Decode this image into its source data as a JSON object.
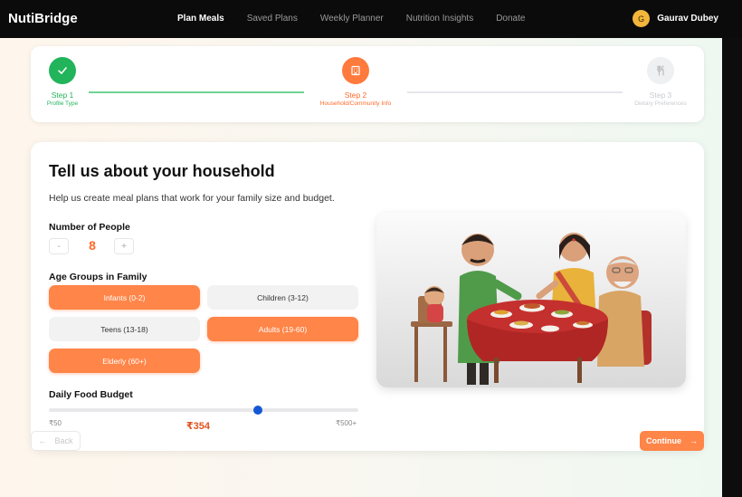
{
  "app": {
    "brand": "NutiBridge"
  },
  "nav": {
    "items": [
      {
        "label": "Plan Meals",
        "active": true
      },
      {
        "label": "Saved Plans",
        "active": false
      },
      {
        "label": "Weekly Planner",
        "active": false
      },
      {
        "label": "Nutrition Insights",
        "active": false
      },
      {
        "label": "Donate",
        "active": false
      }
    ],
    "user": {
      "initial": "G",
      "name": "Gaurav Dubey"
    }
  },
  "stepper": {
    "steps": [
      {
        "title": "Step 1",
        "subtitle": "Profile Type",
        "status": "complete",
        "icon": "check-icon"
      },
      {
        "title": "Step 2",
        "subtitle": "Household/Community Info",
        "status": "current",
        "icon": "building-icon"
      },
      {
        "title": "Step 3",
        "subtitle": "Dietary Preferences",
        "status": "upcoming",
        "icon": "fork-knife-icon"
      }
    ]
  },
  "form": {
    "title": "Tell us about your household",
    "description": "Help us create meal plans that work for your family size and budget.",
    "people": {
      "label": "Number of People",
      "minus": "-",
      "plus": "+",
      "value": "8"
    },
    "age_groups": {
      "label": "Age Groups in Family",
      "options": [
        {
          "label": "Infants (0-2)",
          "selected": true
        },
        {
          "label": "Children (3-12)",
          "selected": false
        },
        {
          "label": "Teens (13-18)",
          "selected": false
        },
        {
          "label": "Adults (19-60)",
          "selected": true
        },
        {
          "label": "Elderly (60+)",
          "selected": true
        }
      ]
    },
    "budget": {
      "label": "Daily Food Budget",
      "min_label": "₹50",
      "max_label": "₹500+",
      "value_label": "₹354",
      "min": 50,
      "max": 500,
      "value": 354
    }
  },
  "footer": {
    "back": "Back",
    "continue": "Continue"
  },
  "colors": {
    "accent": "#ff8548",
    "success": "#22b45a",
    "slider": "#1558d6"
  }
}
